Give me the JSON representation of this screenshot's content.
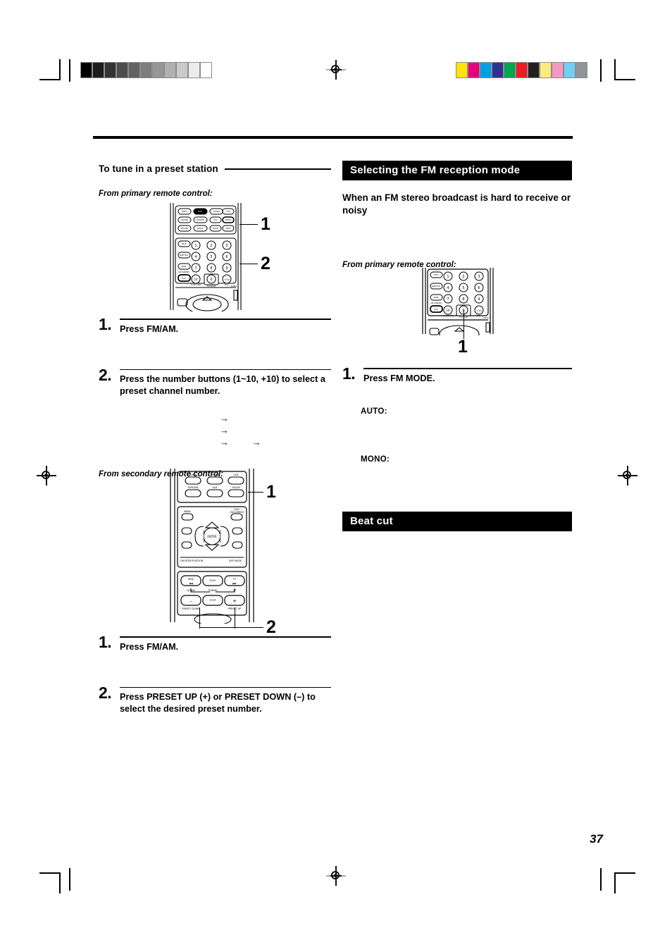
{
  "page": {
    "number": "37"
  },
  "printer_marks": {
    "grayscale_wedge": [
      "#000000",
      "#1c1c1c",
      "#333333",
      "#4d4d4d",
      "#636363",
      "#7d7d7d",
      "#969696",
      "#b0b0b0",
      "#cacaca",
      "#ececec",
      "#ffffff"
    ],
    "color_bars": [
      "#ffe400",
      "#e5007f",
      "#00a0e9",
      "#2e3192",
      "#00a650",
      "#ed1c24",
      "#231f20",
      "#fbea7e",
      "#f49ac1",
      "#6fcff6",
      "#929497"
    ],
    "registration_icon": "registration-target-icon"
  },
  "left_column": {
    "heading": "To tune in a preset station",
    "primary_source_label": "From primary remote control:",
    "primary_callouts": [
      "1",
      "2"
    ],
    "primary_steps": [
      {
        "number": "1.",
        "text": "Press FM/AM."
      },
      {
        "number": "2.",
        "text": "Press the number buttons (1~10, +10) to select a preset channel number."
      }
    ],
    "arrow_rows": [
      {
        "glyphs": [
          "→"
        ]
      },
      {
        "glyphs": [
          "→"
        ]
      },
      {
        "glyphs": [
          "→",
          "→"
        ]
      }
    ],
    "secondary_source_label": "From secondary remote control:",
    "secondary_callouts": [
      "1",
      "2"
    ],
    "secondary_steps": [
      {
        "number": "1.",
        "text": "Press FM/AM."
      },
      {
        "number": "2.",
        "text": "Press PRESET UP (+) or PRESET DOWN (–) to select the desired preset number."
      }
    ]
  },
  "right_column": {
    "section_title": "Selecting the FM reception mode",
    "lead": "When an FM stereo broadcast is hard to receive or noisy",
    "source_label": "From primary remote control:",
    "callouts": [
      "1"
    ],
    "steps": [
      {
        "number": "1.",
        "text": "Press FM MODE."
      }
    ],
    "modes": [
      {
        "term": "AUTO:",
        "description": ""
      },
      {
        "term": "MONO:",
        "description": ""
      }
    ],
    "beat_cut_title": "Beat cut"
  },
  "primary_remote": {
    "source_row_labels": [
      "INPUT",
      "DVD",
      "TV/DBS",
      "VCR"
    ],
    "row2_labels": [
      "SOUND",
      "TAPE/MD",
      "AUX",
      "FM/AM"
    ],
    "row3_labels": [
      "RETURN",
      "ANGLE",
      "ZOOM",
      "MULTI"
    ],
    "side_labels": [
      "TITLE",
      "SUBTITLE",
      "MAIN",
      "DVD"
    ],
    "on_screen_label": "ON SCREEN",
    "keypad": [
      "1",
      "2",
      "3",
      "4",
      "5",
      "6",
      "7",
      "8",
      "9",
      "10",
      "0",
      "+10"
    ],
    "keypad_sub_labels": [
      "TV RETURN",
      "FM MODE",
      "100+"
    ],
    "audio_label": "AUDIO",
    "top_small_label": "TV DIRECT"
  },
  "secondary_remote": {
    "row1_labels": [
      "DVD",
      "TV/DBS",
      "VCR"
    ],
    "row2_labels": [
      "TAPE/MD",
      "AUX",
      "FM/AM"
    ],
    "menu_label": "MENU",
    "on_screen_label": "DVD ON SCREEN",
    "enter_label": "ENTER",
    "theater_label": "THEATER POSITION",
    "dsp_label": "DSP MODE",
    "transport_labels": [
      "REW",
      "PLAY",
      "FF"
    ],
    "tuning_label": "TUNING",
    "tuning_down": "DOWN",
    "tuning_up": "UP",
    "stop_label": "STOP",
    "minus_label": "–",
    "plus_label": "+",
    "preset_down": "PRESET DOWN",
    "preset_up": "PRESET UP"
  }
}
